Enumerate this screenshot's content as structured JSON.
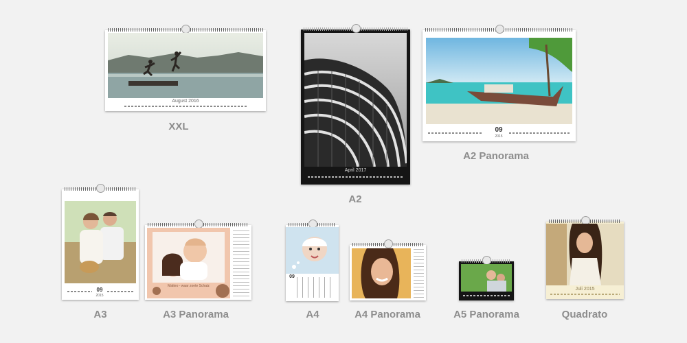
{
  "products": [
    {
      "key": "xxl",
      "label": "XXL",
      "month_text": "August 2016"
    },
    {
      "key": "a2",
      "label": "A2",
      "month_text": "April 2017"
    },
    {
      "key": "a2p",
      "label": "A2 Panorama",
      "day": "09",
      "year": "2015"
    },
    {
      "key": "a3",
      "label": "A3",
      "day": "09",
      "year": "2015"
    },
    {
      "key": "a3p",
      "label": "A3 Panorama",
      "banner_text": "Matteo - waar zoete Schatz"
    },
    {
      "key": "a4",
      "label": "A4",
      "day": "09"
    },
    {
      "key": "a4p",
      "label": "A4 Panorama"
    },
    {
      "key": "a5p",
      "label": "A5 Panorama"
    },
    {
      "key": "quadrato",
      "label": "Quadrato",
      "month_text": "Juli 2015"
    }
  ]
}
